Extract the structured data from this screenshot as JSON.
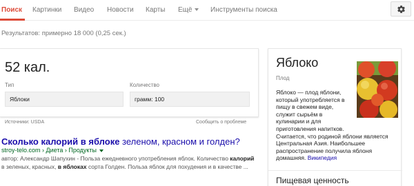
{
  "nav": {
    "tabs": [
      {
        "label": "Поиск",
        "active": true
      },
      {
        "label": "Картинки",
        "active": false
      },
      {
        "label": "Видео",
        "active": false
      },
      {
        "label": "Новости",
        "active": false
      },
      {
        "label": "Карты",
        "active": false
      },
      {
        "label": "Ещё",
        "active": false,
        "dropdown": true
      },
      {
        "label": "Инструменты поиска",
        "active": false
      }
    ],
    "settings_icon": "gear-icon",
    "accent_color": "#dd4b39"
  },
  "stats": "Результатов: примерно 18 000 (0,25 сек.)",
  "calc_card": {
    "value": "52 кал.",
    "type_label": "Тип",
    "type_value": "Яблоки",
    "quantity_label": "Количество",
    "quantity_value": "грамм: 100",
    "source": "Источники: USDA",
    "report": "Сообщить о проблеме"
  },
  "result": {
    "title_bold": "Сколько калорий в яблоке",
    "title_rest": " зеленом, красном и голден?",
    "url": "stroy-telo.com › Диета › Продукты",
    "snippet": {
      "part1": "автор: Александр Шапухин - Польза ежедневного употребления яблок. Количество ",
      "bold1": "калорий",
      "part2": " в зеленых, красных, ",
      "bold2": "в яблоках",
      "part3": " сорта Голден. Польза яблок для похудения и в качестве ..."
    },
    "link_color": "#1a0dab",
    "url_color": "#006621"
  },
  "knowledge_panel": {
    "title": "Яблоко",
    "subtitle": "Плод",
    "image_icon": "apples-image",
    "description_lines": [
      "Яблоко — плод яблони,",
      "который употребляется в",
      "пищу в свежем виде,",
      "служит сырьём в",
      "кулинарии и для",
      "приготовления напитков.",
      "Считается, что родиной яблони является",
      "Центральная Азия. Наибольшее",
      "распространение получила яблоня"
    ],
    "description_last": "домашняя.",
    "source_link": "Википедия",
    "section_title": "Пищевая ценность"
  }
}
